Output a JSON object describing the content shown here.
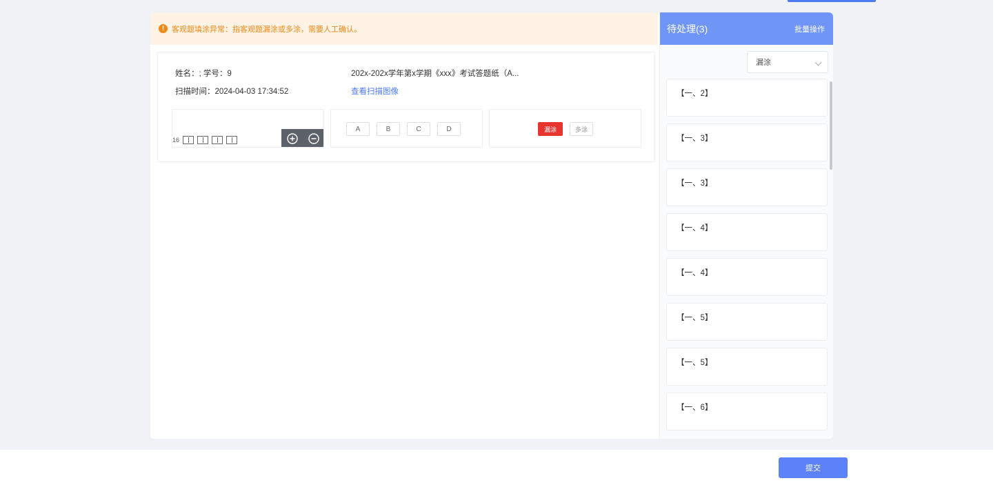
{
  "alert": {
    "icon": "warning-icon",
    "text": "客观题填涂异常：指客观题漏涂或多涂，需要人工确认。"
  },
  "student": {
    "name_line": "姓名：; 学号：9",
    "scan_time": "扫描时间：2024-04-03 17:34:52",
    "exam_title": "202x-202x学年第x学期《xxx》考试答题纸（A...",
    "view_scan_link": "查看扫描图像"
  },
  "preview": {
    "row_label": "16",
    "zoom_in_icon": "zoom-in-icon",
    "zoom_out_icon": "zoom-out-icon"
  },
  "choices": [
    "A",
    "B",
    "C",
    "D"
  ],
  "tags": {
    "active": "漏涂",
    "plain": "多涂"
  },
  "sidebar": {
    "title": "待处理(3)",
    "batch_action": "批量操作",
    "filter_value": "漏涂",
    "items": [
      "【一、2】",
      "【一、3】",
      "【一、3】",
      "【一、4】",
      "【一、4】",
      "【一、5】",
      "【一、5】",
      "【一、6】"
    ]
  },
  "footer": {
    "submit_label": "提交"
  },
  "colors": {
    "accent": "#5b82f8",
    "header_blue": "#6f95f7",
    "warning": "#f08a18",
    "danger": "#e8342f"
  }
}
